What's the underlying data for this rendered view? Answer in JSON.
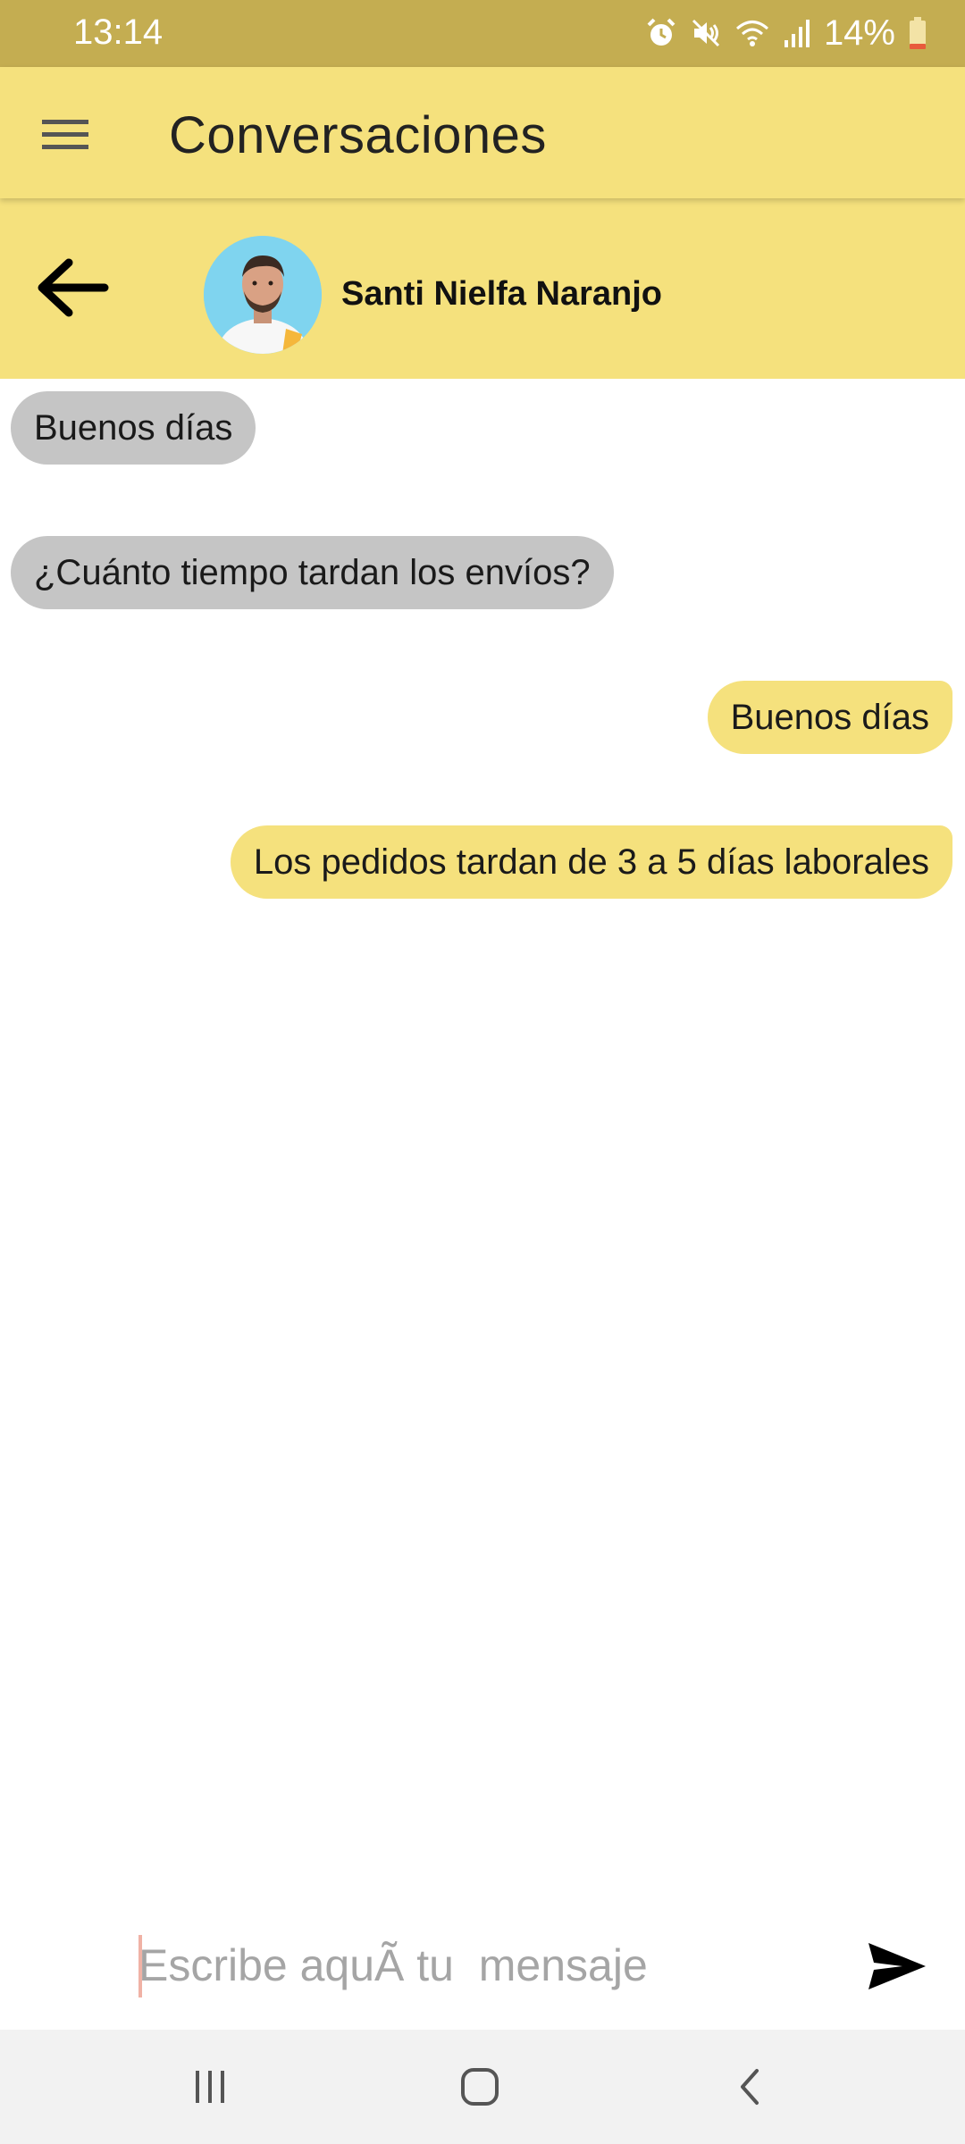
{
  "status_bar": {
    "time": "13:14",
    "battery": "14%",
    "icons": [
      "alarm-icon",
      "mute-icon",
      "wifi-icon",
      "signal-icon",
      "battery-icon"
    ]
  },
  "app_bar": {
    "title": "Conversaciones",
    "menu_icon": "hamburger-menu-icon"
  },
  "contact": {
    "name": "Santi Nielfa Naranjo",
    "back_icon": "arrow-left-icon"
  },
  "messages": [
    {
      "direction": "incoming",
      "text": "Buenos días"
    },
    {
      "direction": "incoming",
      "text": "¿Cuánto tiempo tardan los envíos?"
    },
    {
      "direction": "outgoing",
      "text": "Buenos días"
    },
    {
      "direction": "outgoing",
      "text": "Los pedidos tardan de 3 a 5 días laborales"
    }
  ],
  "composer": {
    "placeholder": "Escribe aquÃ tu  mensaje",
    "send_icon": "send-icon"
  },
  "nav": {
    "icons": [
      "recent-apps-icon",
      "home-icon",
      "back-icon"
    ]
  },
  "colors": {
    "status_bar": "#c4ad51",
    "accent_yellow": "#f5e17d",
    "incoming_bubble": "#c5c5c5",
    "nav_bar": "#f2f2f2"
  }
}
